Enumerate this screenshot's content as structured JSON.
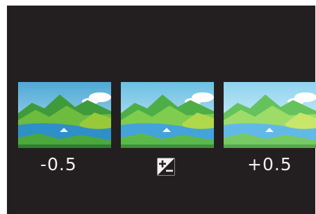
{
  "bracket": {
    "frames": [
      {
        "label": "-0.5",
        "exposure": -0.5
      },
      {
        "label": "",
        "exposure": 0
      },
      {
        "label": "+0.5",
        "exposure": 0.5
      }
    ],
    "center_icon": "exposure-compensation-icon"
  },
  "colors": {
    "background": "#231f20",
    "text": "#f2f2f2"
  }
}
